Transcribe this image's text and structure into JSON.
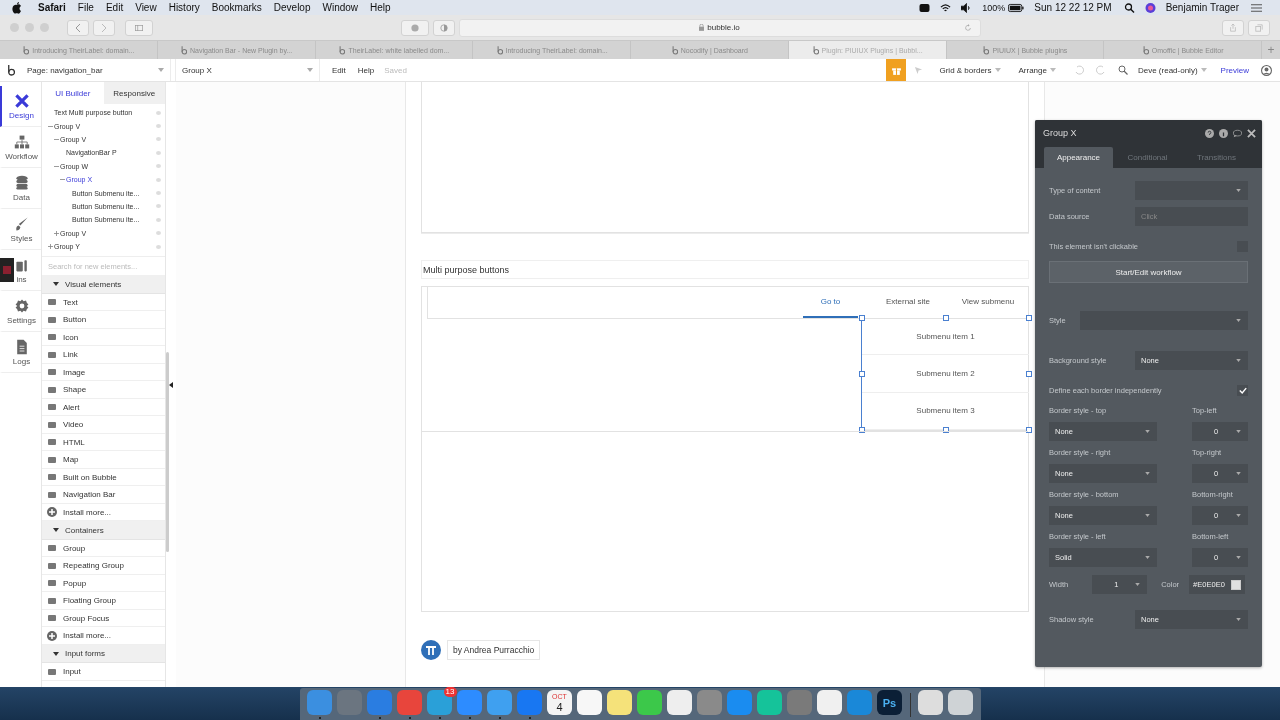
{
  "menu_bar": {
    "app": "Safari",
    "menus": [
      "File",
      "Edit",
      "View",
      "History",
      "Bookmarks",
      "Develop",
      "Window",
      "Help"
    ],
    "battery": "100%",
    "clock": "Sun 12 22 12 PM",
    "user": "Benjamin Trager"
  },
  "browser": {
    "url": "bubble.io",
    "tabs": [
      {
        "label": "Introducing TheirLabel: domain...",
        "selected": false
      },
      {
        "label": "Navigation Bar - New Plugin by...",
        "selected": false
      },
      {
        "label": "TheirLabel: white labelled dom...",
        "selected": false
      },
      {
        "label": "Introducing TheirLabel: domain...",
        "selected": false
      },
      {
        "label": "Nocodify | Dashboard",
        "selected": false
      },
      {
        "label": "Plugin: PIUIUX Plugins | Bubbl...",
        "selected": true
      },
      {
        "label": "PIUIUX | Bubble plugins",
        "selected": false
      },
      {
        "label": "Omoffic | Bubble Editor",
        "selected": false
      }
    ],
    "new_tab": "+"
  },
  "editor_bar": {
    "page": "Page: navigation_bar",
    "element": "Group X",
    "menus": [
      "Edit",
      "Help"
    ],
    "status": "Saved",
    "grid": "Grid & borders",
    "arrange": "Arrange",
    "mode": "Deve (read-only)",
    "preview": "Preview"
  },
  "rail": [
    {
      "label": "Design",
      "selected": true
    },
    {
      "label": "Workflow",
      "selected": false
    },
    {
      "label": "Data",
      "selected": false
    },
    {
      "label": "Styles",
      "selected": false
    },
    {
      "label": "ins",
      "selected": false
    },
    {
      "label": "Settings",
      "selected": false
    },
    {
      "label": "Logs",
      "selected": false
    }
  ],
  "panel_tabs": [
    {
      "label": "UI Builder",
      "selected": true
    },
    {
      "label": "Responsive",
      "selected": false
    }
  ],
  "tree": [
    {
      "label": "Text Multi purpose button",
      "selected": false
    },
    {
      "label": "Group V",
      "selected": false,
      "expanded": true,
      "children": [
        {
          "label": "Group V",
          "selected": false,
          "expanded": true,
          "children": [
            {
              "label": "NavigationBar P",
              "selected": false
            }
          ]
        },
        {
          "label": "Group W",
          "selected": false,
          "expanded": true,
          "children": [
            {
              "label": "Group X",
              "selected": true,
              "expanded": true,
              "children": [
                {
                  "label": "Button Submenu ite...",
                  "selected": false
                },
                {
                  "label": "Button Submenu ite...",
                  "selected": false
                },
                {
                  "label": "Button Submenu ite...",
                  "selected": false
                }
              ]
            }
          ]
        },
        {
          "label": "Group V",
          "selected": false,
          "expanded": false
        }
      ]
    },
    {
      "label": "Group Y",
      "selected": false,
      "expanded": false
    }
  ],
  "element_search": {
    "placeholder": "Search for new elements..."
  },
  "elements": [
    {
      "kind": "header",
      "label": "Visual elements",
      "expanded": true
    },
    {
      "kind": "item",
      "label": "Text"
    },
    {
      "kind": "item",
      "label": "Button"
    },
    {
      "kind": "item",
      "label": "Icon"
    },
    {
      "kind": "item",
      "label": "Link"
    },
    {
      "kind": "item",
      "label": "Image"
    },
    {
      "kind": "item",
      "label": "Shape"
    },
    {
      "kind": "item",
      "label": "Alert"
    },
    {
      "kind": "item",
      "label": "Video"
    },
    {
      "kind": "item",
      "label": "HTML"
    },
    {
      "kind": "item",
      "label": "Map"
    },
    {
      "kind": "item",
      "label": "Built on Bubble"
    },
    {
      "kind": "item",
      "label": "Navigation Bar"
    },
    {
      "kind": "install",
      "label": "Install more..."
    },
    {
      "kind": "header",
      "label": "Containers",
      "expanded": true
    },
    {
      "kind": "item",
      "label": "Group"
    },
    {
      "kind": "item",
      "label": "Repeating Group"
    },
    {
      "kind": "item",
      "label": "Popup"
    },
    {
      "kind": "item",
      "label": "Floating Group"
    },
    {
      "kind": "item",
      "label": "Group Focus"
    },
    {
      "kind": "install",
      "label": "Install more..."
    },
    {
      "kind": "header",
      "label": "Input forms",
      "expanded": true
    },
    {
      "kind": "item",
      "label": "Input"
    }
  ],
  "canvas": {
    "section_title": "Multi purpose buttons",
    "nav_tabs": [
      {
        "label": "Go to",
        "selected": true
      },
      {
        "label": "External site",
        "selected": false
      },
      {
        "label": "View submenu",
        "selected": false
      }
    ],
    "submenu": [
      "Submenu item 1",
      "Submenu item 2",
      "Submenu item 3"
    ],
    "footer": "by Andrea Purracchio"
  },
  "property_panel": {
    "title": "Group X",
    "tabs": [
      {
        "label": "Appearance",
        "selected": true
      },
      {
        "label": "Conditional",
        "selected": false
      },
      {
        "label": "Transitions",
        "selected": false
      }
    ],
    "rows": [
      {
        "kind": "select",
        "label": "Type of content"
      },
      {
        "kind": "input",
        "label": "Data source",
        "placeholder": "Click"
      },
      {
        "kind": "checkbox",
        "label": "This element isn't clickable",
        "checked": false
      },
      {
        "kind": "button",
        "label": "Start/Edit workflow"
      },
      {
        "kind": "select",
        "label": "Style"
      },
      {
        "kind": "select",
        "label": "Background style",
        "value": "None"
      },
      {
        "kind": "checkbox",
        "label": "Define each border independently",
        "checked": true
      },
      {
        "kind": "pair",
        "label": "Border style - top",
        "value": "None",
        "label2": "Top-left",
        "value2": "0"
      },
      {
        "kind": "pair",
        "label": "Border style - right",
        "value": "None",
        "label2": "Top-right",
        "value2": "0"
      },
      {
        "kind": "pair",
        "label": "Border style - bottom",
        "value": "None",
        "label2": "Bottom-right",
        "value2": "0"
      },
      {
        "kind": "pair",
        "label": "Border style - left",
        "value": "Solid",
        "label2": "Bottom-left",
        "value2": "0"
      },
      {
        "kind": "width",
        "label": "Width",
        "value": "1",
        "label2": "Color",
        "value2": "#E0E0E0"
      },
      {
        "kind": "select",
        "label": "Shadow style",
        "value": "None"
      }
    ]
  },
  "dock": [
    {
      "color": "#3b8fe0",
      "running": true
    },
    {
      "color": "#6b7580",
      "running": false
    },
    {
      "color": "#2a7de1",
      "running": true
    },
    {
      "color": "#e8453c",
      "running": true
    },
    {
      "color": "#2aa0d8",
      "running": true,
      "badge": "13"
    },
    {
      "color": "#2d8cff",
      "running": true
    },
    {
      "color": "#3fa0f0",
      "running": true
    },
    {
      "color": "#1877f2",
      "running": true
    },
    {
      "color": "#f4f4f4",
      "running": false,
      "month": "OCT",
      "day": "4"
    },
    {
      "color": "#f7f7f7",
      "running": false
    },
    {
      "color": "#f5e27a",
      "running": false
    },
    {
      "color": "#3cc84a",
      "running": false
    },
    {
      "color": "#eeeeee",
      "running": false
    },
    {
      "color": "#8a8a8a",
      "running": false
    },
    {
      "color": "#1a8cf0",
      "running": false
    },
    {
      "color": "#15c39a",
      "running": false
    },
    {
      "color": "#7a7a7a",
      "running": false
    },
    {
      "color": "#f0f0f0",
      "running": false
    },
    {
      "color": "#1a88d8",
      "running": false
    },
    {
      "color": "#0b1f36",
      "running": false,
      "text": "Ps"
    },
    {
      "color": "#dddddd",
      "running": false,
      "separator_before": true
    },
    {
      "color": "#cfd3d6",
      "running": false
    }
  ]
}
